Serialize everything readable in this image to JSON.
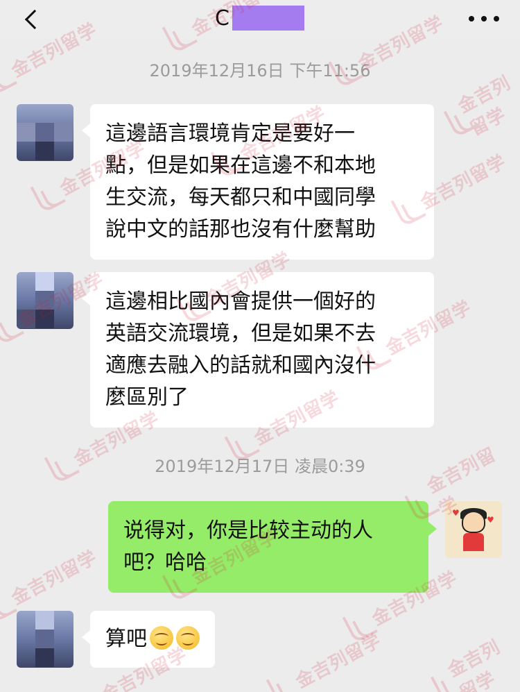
{
  "header": {
    "back_icon": "chevron-left-icon",
    "title": "C",
    "more_icon": "more-dots-icon"
  },
  "watermark": {
    "text": "金吉列留学",
    "color": "#d3152b"
  },
  "timestamps": [
    "2019年12月16日 下午11:56",
    "2019年12月17日 凌晨0:39"
  ],
  "messages": [
    {
      "side": "in",
      "lines": [
        "這邊語言環境肯定是要好一",
        "點，但是如果在這邊不和本地",
        "生交流，每天都只和中國同學",
        "說中文的話那也沒有什麼幫助"
      ]
    },
    {
      "side": "in",
      "lines": [
        "這邊相比國內會提供一個好的",
        "英語交流環境，但是如果不去",
        "適應去融入的話就和國內沒什",
        "麼區別了"
      ]
    },
    {
      "side": "out",
      "lines": [
        "说得对，你是比较主动的人",
        "吧？哈哈"
      ]
    },
    {
      "side": "in",
      "text": "算吧",
      "emojis": [
        "smile-emoji",
        "smile-emoji"
      ]
    }
  ],
  "colors": {
    "background": "#ececec",
    "bubble_in": "#ffffff",
    "bubble_out": "#95ec69",
    "timestamp": "#9b9b9b",
    "title_redaction": "#a47cf0"
  }
}
